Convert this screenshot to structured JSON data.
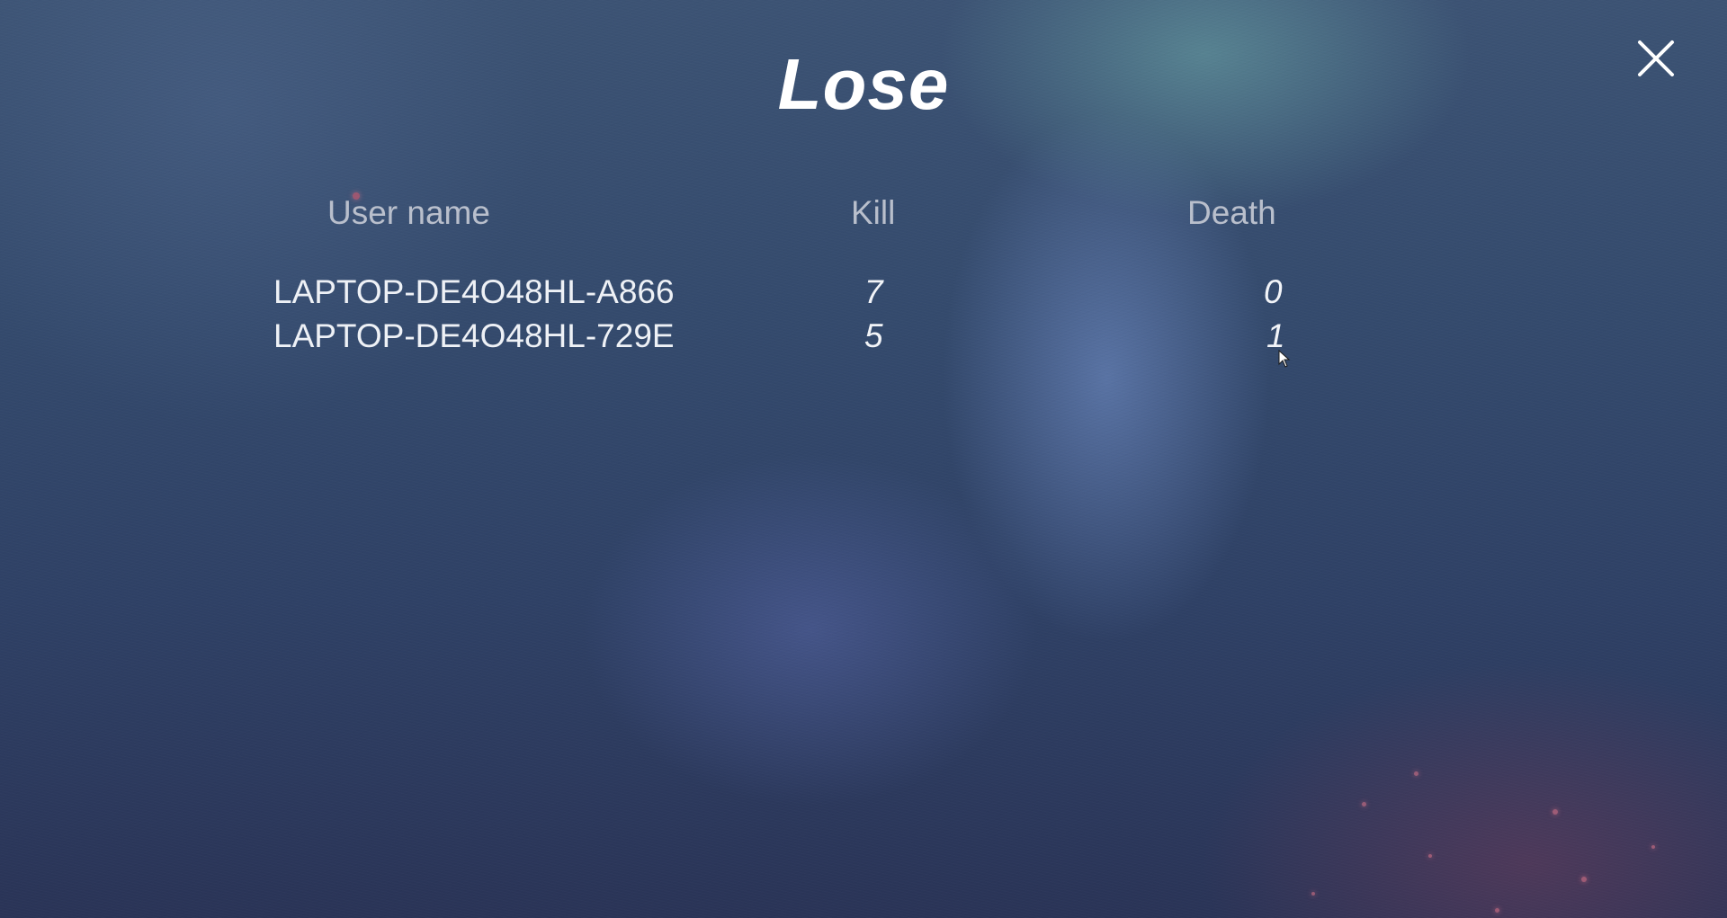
{
  "result": {
    "title": "Lose"
  },
  "close_icon": "close-icon",
  "scoreboard": {
    "headers": {
      "username": "User name",
      "kill": "Kill",
      "death": "Death"
    },
    "rows": [
      {
        "username": "LAPTOP-DE4O48HL-A866",
        "kill": "7",
        "death": "0"
      },
      {
        "username": "LAPTOP-DE4O48HL-729E",
        "kill": "5",
        "death": "1"
      }
    ]
  }
}
